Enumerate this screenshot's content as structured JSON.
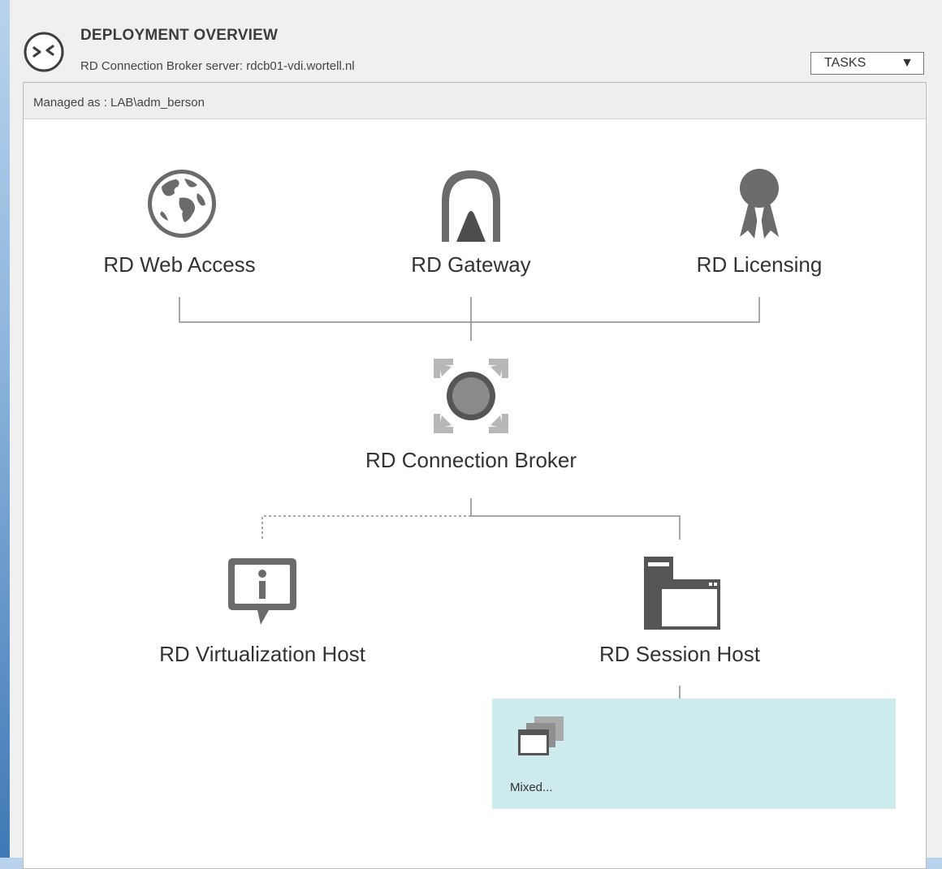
{
  "header": {
    "title": "DEPLOYMENT OVERVIEW",
    "subtitle": "RD Connection Broker server: rdcb01-vdi.wortell.nl",
    "icon": "remote-desktop-icon",
    "tasks_label": "TASKS",
    "tasks_arrow": "▼"
  },
  "panel": {
    "managed_as": "Managed as : LAB\\adm_berson"
  },
  "nodes": {
    "web_access": {
      "label": "RD Web Access",
      "icon": "globe-icon"
    },
    "gateway": {
      "label": "RD Gateway",
      "icon": "tunnel-icon"
    },
    "licensing": {
      "label": "RD Licensing",
      "icon": "ribbon-award-icon"
    },
    "connection_broker": {
      "label": "RD Connection Broker",
      "icon": "broker-icon"
    },
    "virtualization_host": {
      "label": "RD Virtualization Host",
      "icon": "info-bubble-icon"
    },
    "session_host": {
      "label": "RD Session Host",
      "icon": "server-window-icon"
    }
  },
  "collection": {
    "label": "Mixed...",
    "icon": "collection-windows-icon"
  },
  "colors": {
    "icon_gray": "#6b6b6b",
    "collection_bg": "#cdeaed",
    "panel_border": "#bcbcbc"
  }
}
